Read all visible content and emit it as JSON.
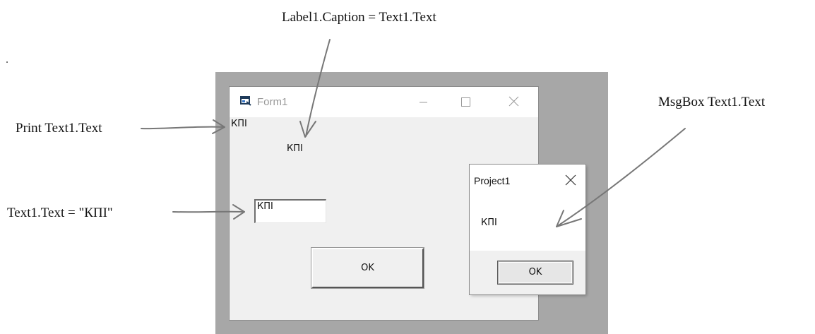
{
  "annotations": {
    "label_caption": "Label1.Caption = Text1.Text",
    "print": "Print Text1.Text",
    "msgbox": "MsgBox Text1.Text",
    "text_assign": "Text1.Text = \"КПІ\""
  },
  "form1": {
    "title": "Form1",
    "printed_text": "КПІ",
    "label1_caption": "КПІ",
    "text1_value": "КПІ",
    "ok_button_label": "OK",
    "minimize_glyph": "—",
    "maximize_glyph": "☐",
    "close_glyph": "✕"
  },
  "msgbox": {
    "title": "Project1",
    "message": "КПІ",
    "ok_button_label": "OK"
  },
  "colors": {
    "backdrop": "#a7a7a7",
    "form_body": "#f0f0f0",
    "titlebar": "#ffffff",
    "arrow": "#777777"
  },
  "icons": [
    "form-app-icon",
    "minimize-icon",
    "maximize-icon",
    "close-icon",
    "msgbox-close-icon"
  ]
}
